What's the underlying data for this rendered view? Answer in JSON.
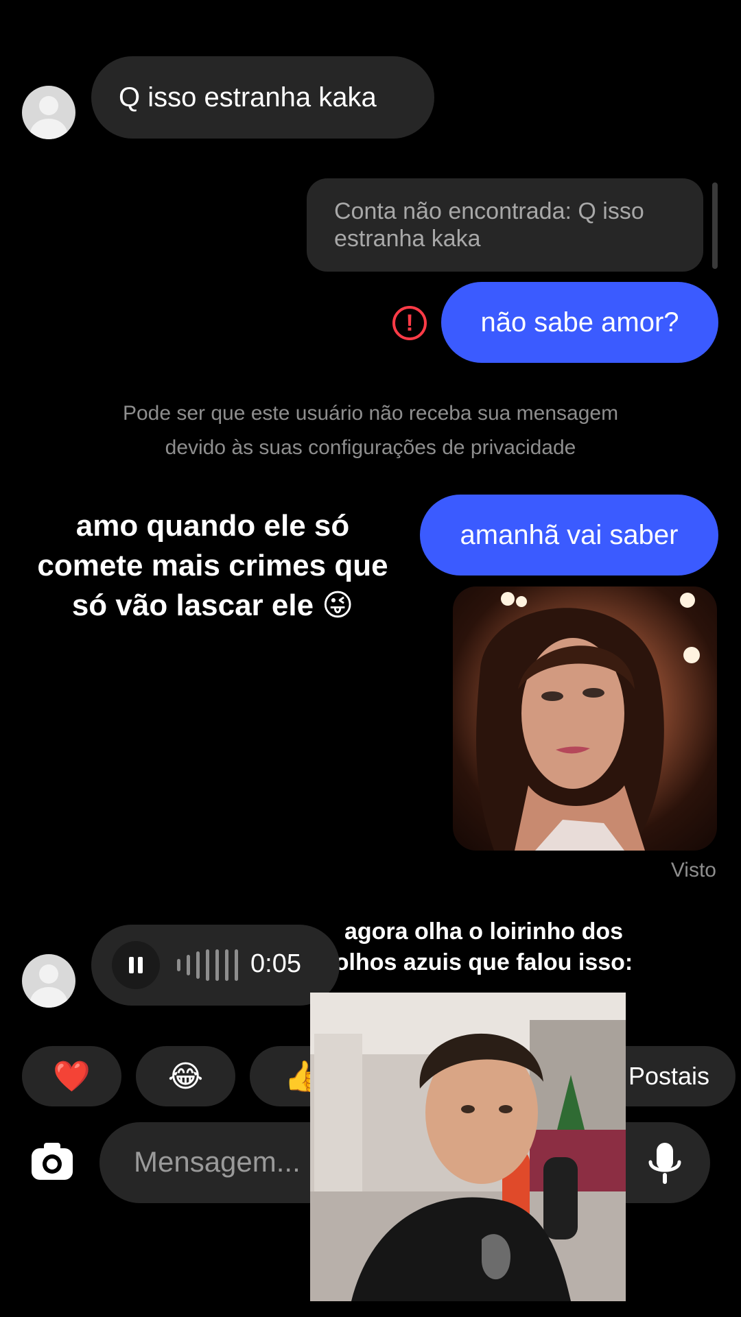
{
  "thread": {
    "incoming_text": "Q isso estranha kaka",
    "quoted_reply": "Conta não encontrada: Q isso estranha kaka",
    "outgoing_failed": "não sabe amor?",
    "error_icon": "!",
    "privacy_notice_line1": "Pode ser que este usuário não receba sua mensagem",
    "privacy_notice_line2": "devido às suas configurações de privacidade",
    "outgoing_second": "amanhã vai saber",
    "seen_status": "Visto",
    "audio_duration": "0:05"
  },
  "overlays": {
    "caption_top_line1": "amo quando ele só",
    "caption_top_line2": "comete mais crimes que",
    "caption_top_line3": "só vão lascar ele 😜",
    "caption_bottom_line1": "agora olha o loirinho dos",
    "caption_bottom_line2": "olhos azuis que falou isso:"
  },
  "reactions": [
    {
      "emoji": "❤️"
    },
    {
      "emoji": "😂"
    },
    {
      "emoji": "👍"
    },
    {
      "label": "Postais"
    }
  ],
  "composer": {
    "placeholder": "Mensagem..."
  },
  "icons": {
    "camera": "camera-icon",
    "mic": "microphone-icon",
    "pause": "pause-icon",
    "alert": "alert-circle-icon"
  },
  "colors": {
    "background": "#000000",
    "bubble_incoming": "#262626",
    "bubble_outgoing": "#3b5bff",
    "error": "#ff3b47",
    "muted_text": "#8e8e8e"
  }
}
